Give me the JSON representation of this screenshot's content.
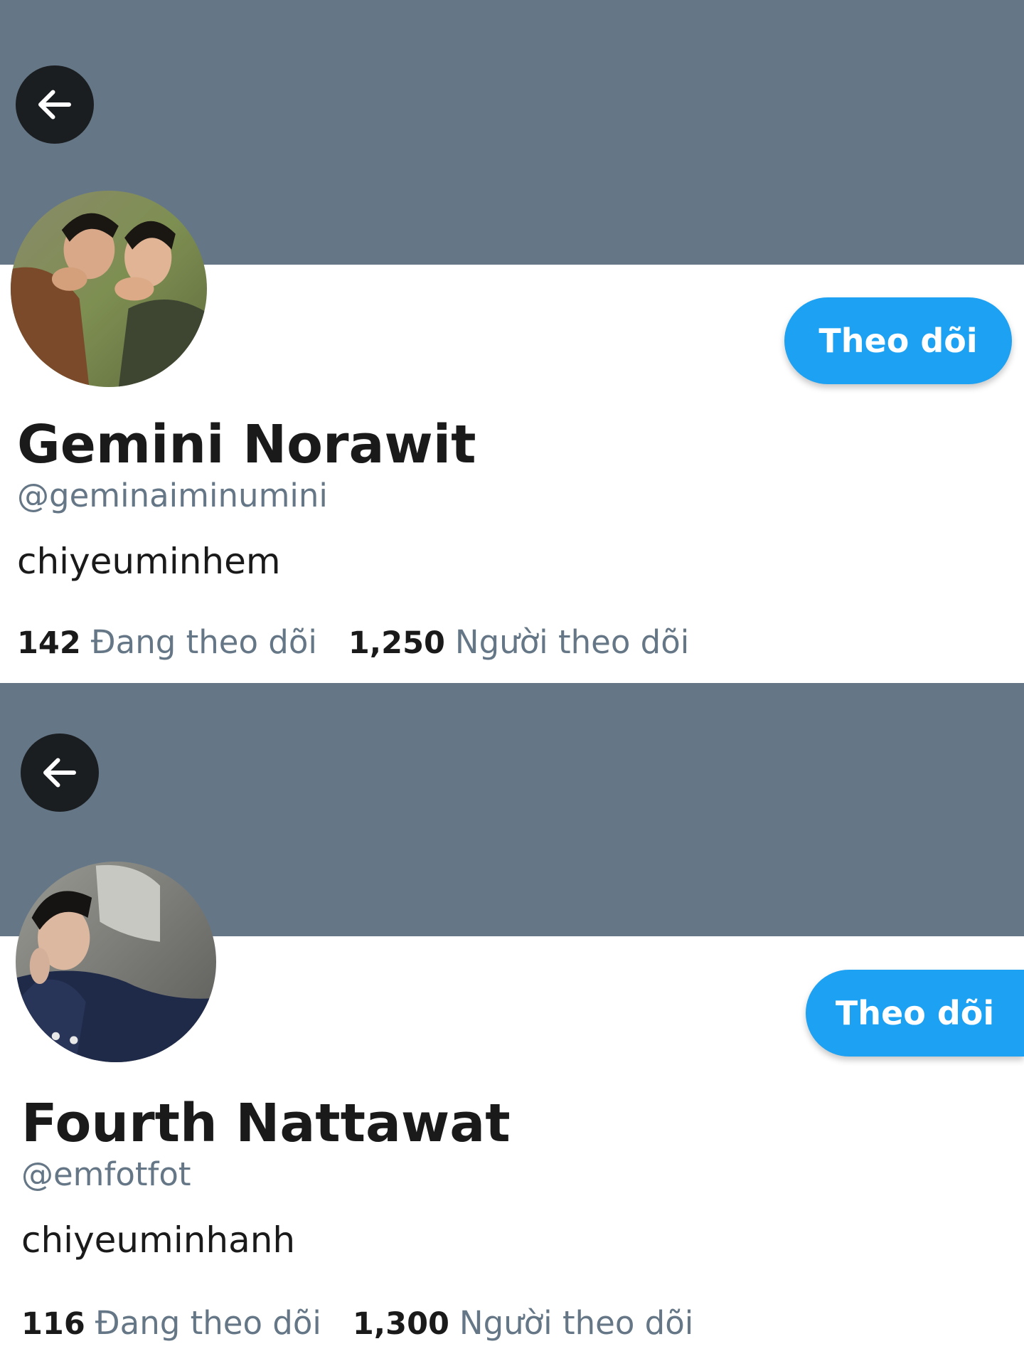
{
  "profiles": [
    {
      "display_name": "Gemini Norawit",
      "handle": "@geminaiminumini",
      "bio": "chiyeuminhem",
      "follow_label": "Theo dõi",
      "following_count": "142",
      "following_label": "Đang theo dõi",
      "followers_count": "1,250",
      "followers_label": "Người theo dõi"
    },
    {
      "display_name": "Fourth Nattawat",
      "handle": "@emfotfot",
      "bio": "chiyeuminhanh",
      "follow_label": "Theo dõi",
      "following_count": "116",
      "following_label": "Đang theo dõi",
      "followers_count": "1,300",
      "followers_label": "Người theo dõi"
    }
  ],
  "icons": {
    "back": "arrow-left-icon"
  },
  "colors": {
    "banner": "#657786",
    "accent": "#1da1f2",
    "muted_text": "#657786",
    "back_button": "#1b1e21"
  }
}
